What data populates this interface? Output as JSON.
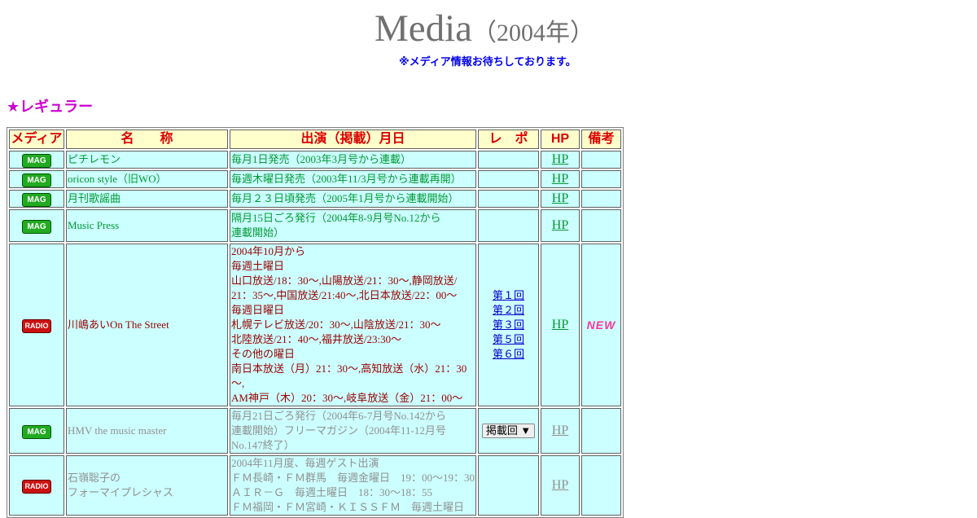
{
  "header": {
    "title": "Media",
    "year": "（2004年）",
    "notice": "※メディア情報お待ちしております。"
  },
  "section_title": "★レギュラー",
  "table": {
    "headers": [
      "メディア",
      "名　　称",
      "出演（掲載）月日",
      "レ　ポ",
      "HP",
      "備考"
    ],
    "rows": [
      {
        "media": "MAG",
        "name": "ピチレモン",
        "date_lines": [
          "毎月1日発売（2003年3月号から連載）"
        ],
        "hp": "HP"
      },
      {
        "media": "MAG",
        "name": "oricon style（旧WO）",
        "date_lines": [
          "毎週木曜日発売（2003年11/3月号から連載再開）"
        ],
        "hp": "HP"
      },
      {
        "media": "MAG",
        "name": "月刊歌謡曲",
        "date_lines": [
          "毎月２３日頃発売（2005年1月号から連載開始）"
        ],
        "hp": "HP"
      },
      {
        "media": "MAG",
        "name": "Music Press",
        "date_lines": [
          "隔月15日ごろ発行（2004年8-9月号No.12から",
          "連載開始）"
        ],
        "hp": "HP"
      },
      {
        "media": "RADIO",
        "name": "川嶋あいOn The Street",
        "date_lines": [
          "2004年10月から",
          "毎週土曜日",
          "山口放送/18：30～,山陽放送/21：30～,静岡放送/",
          "21：35～,中国放送/21:40～,北日本放送/22：00～",
          "毎週日曜日",
          "札幌テレビ放送/20：30～,山陰放送/21：30～",
          "北陸放送/21：40～,福井放送/23:30～",
          "その他の曜日",
          "南日本放送（月）21：30～,高知放送（水）21：30",
          "～,",
          "AM神戸（木）20：30～,岐阜放送（金）21：00～"
        ],
        "repo": [
          "第１回",
          "第２回",
          "第３回",
          "第５回",
          "第６回"
        ],
        "hp": "HP",
        "note": "NEW"
      },
      {
        "media": "MAG",
        "name": "HMV the music master",
        "date_lines": [
          "毎月21日ごろ発行（2004年6-7月号No.142から",
          "連載開始）フリーマガジン（2004年11-12月号",
          "No.147終了）"
        ],
        "repo_select": "掲載回",
        "hp": "HP"
      },
      {
        "media": "RADIO",
        "name": "石嶺聡子の",
        "name2": "フォーマイプレシャス",
        "date_lines": [
          "2004年11月度、毎週ゲスト出演",
          "ＦＭ長崎・ＦＭ群馬　毎週金曜日　19：00～19：30",
          "ＡＩＲ－Ｇ　毎週土曜日　18：30～18：55",
          "ＦＭ福岡・ＦＭ宮崎・ＫＩＳＳＦＭ　毎週土曜日"
        ],
        "hp": "HP"
      }
    ]
  }
}
